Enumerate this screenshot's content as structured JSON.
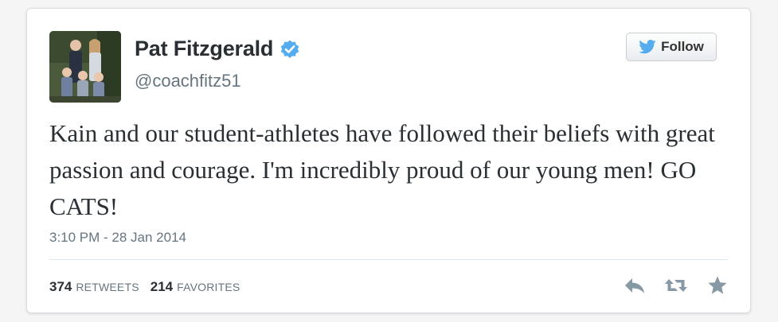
{
  "tweet": {
    "author": {
      "display_name": "Pat Fitzgerald",
      "handle": "@coachfitz51",
      "verified": true
    },
    "follow_button": {
      "label": "Follow",
      "icon": "twitter-bird-icon"
    },
    "text": "Kain and our student-athletes have followed their beliefs with great passion and courage. I'm incredibly proud of our young men! GO CATS!",
    "timestamp": "3:10 PM - 28 Jan 2014",
    "stats": {
      "retweets_count": "374",
      "retweets_label": "RETWEETS",
      "favorites_count": "214",
      "favorites_label": "FAVORITES"
    },
    "actions": [
      {
        "name": "reply",
        "icon": "reply-icon"
      },
      {
        "name": "retweet",
        "icon": "retweet-icon"
      },
      {
        "name": "favorite",
        "icon": "star-icon"
      }
    ]
  },
  "colors": {
    "verified_blue": "#55acee",
    "twitter_blue": "#55acee",
    "text_dark": "#292f33",
    "text_gray": "#66757f",
    "icon_gray": "#8899a6"
  }
}
